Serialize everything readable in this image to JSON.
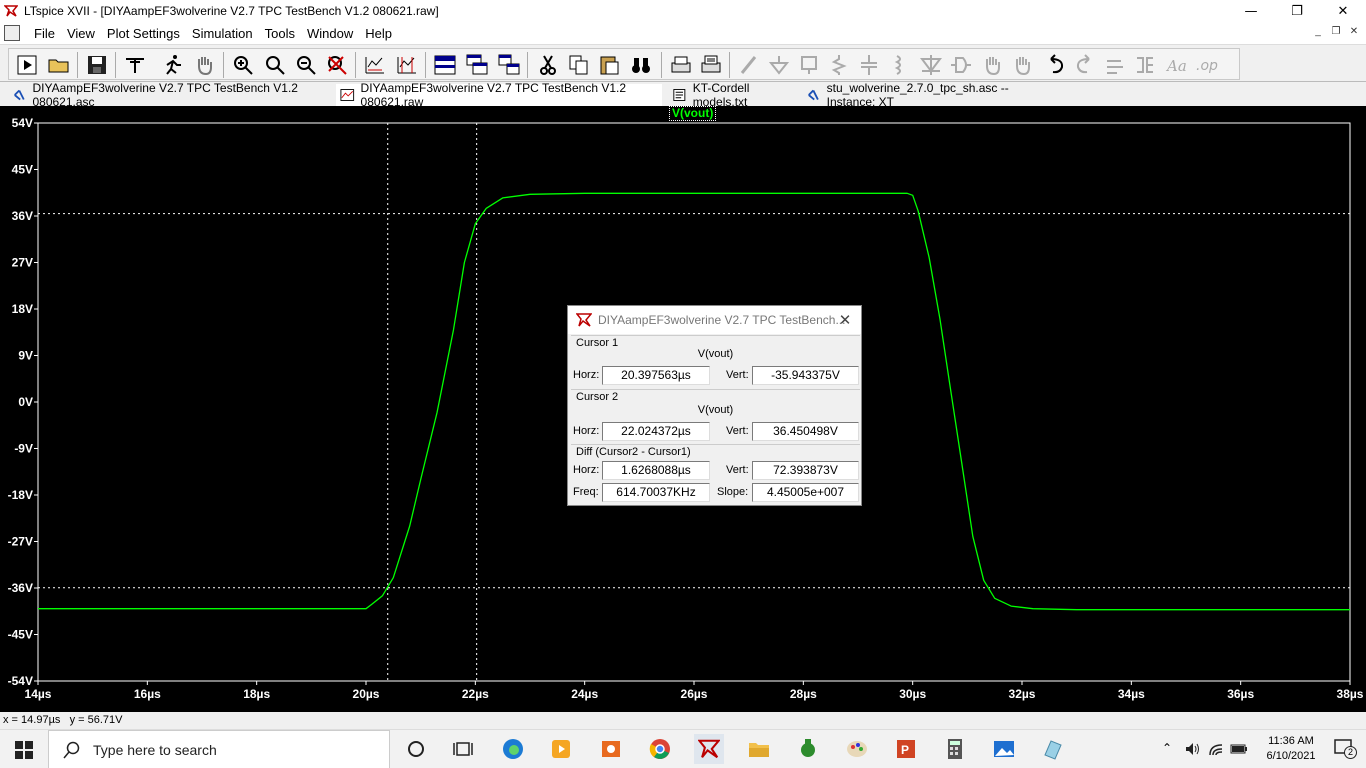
{
  "window": {
    "title": "LTspice XVII - [DIYAampEF3wolverine V2.7 TPC TestBench V1.2 080621.raw]",
    "minimize_glyph": "—",
    "maximize_glyph": "❐",
    "close_glyph": "✕"
  },
  "menu": {
    "items": [
      "File",
      "View",
      "Plot Settings",
      "Simulation",
      "Tools",
      "Window",
      "Help"
    ],
    "mdi_glyphs": [
      "_",
      "❐",
      "✕"
    ]
  },
  "tabs": [
    {
      "label": "DIYAampEF3wolverine V2.7 TPC TestBench V1.2 080621.asc",
      "icon": "schematic-icon",
      "active": false
    },
    {
      "label": "DIYAampEF3wolverine V2.7 TPC TestBench V1.2 080621.raw",
      "icon": "waveform-icon",
      "active": true
    },
    {
      "label": "KT-Cordell models.txt",
      "icon": "text-file-icon",
      "active": false
    },
    {
      "label": "stu_wolverine_2.7.0_tpc_sh.asc -- Instance: XT",
      "icon": "schematic-icon",
      "active": false
    }
  ],
  "plot": {
    "trace_label": "V(vout)",
    "trace_color": "#00ff00",
    "background": "#000000",
    "cursor_line_color": "#ffffff"
  },
  "chart_data": {
    "type": "line",
    "title": "",
    "xlabel": "",
    "ylabel": "",
    "xlim": [
      14,
      38
    ],
    "ylim": [
      -54,
      54
    ],
    "x_unit": "µs",
    "y_unit": "V",
    "x_ticks": [
      "14µs",
      "16µs",
      "18µs",
      "20µs",
      "22µs",
      "24µs",
      "26µs",
      "28µs",
      "30µs",
      "32µs",
      "34µs",
      "36µs",
      "38µs"
    ],
    "y_ticks": [
      "54V",
      "45V",
      "36V",
      "27V",
      "18V",
      "9V",
      "0V",
      "-9V",
      "-18V",
      "-27V",
      "-36V",
      "-45V",
      "-54V"
    ],
    "grid": false,
    "series": [
      {
        "name": "V(vout)",
        "x": [
          14.0,
          20.0,
          20.1,
          20.3,
          20.5,
          20.8,
          21.0,
          21.3,
          21.6,
          21.8,
          22.0,
          22.2,
          22.5,
          23.0,
          24.0,
          26.0,
          28.0,
          29.9,
          30.0,
          30.1,
          30.3,
          30.5,
          30.7,
          30.9,
          31.1,
          31.3,
          31.5,
          31.8,
          32.2,
          33.0,
          38.0
        ],
        "y": [
          -40.0,
          -40.0,
          -39.2,
          -37.5,
          -34.0,
          -24.0,
          -15.0,
          -2.0,
          14.0,
          27.0,
          34.5,
          37.5,
          39.5,
          40.2,
          40.4,
          40.4,
          40.4,
          40.4,
          40.0,
          37.0,
          28.0,
          16.0,
          2.0,
          -12.0,
          -26.0,
          -34.5,
          -38.0,
          -39.5,
          -40.0,
          -40.2,
          -40.2
        ]
      }
    ],
    "cursors": {
      "cursor1": {
        "x": 20.397563,
        "y": -35.943375
      },
      "cursor2": {
        "x": 22.024372,
        "y": 36.450498
      }
    }
  },
  "cursor_dialog": {
    "title": "DIYAampEF3wolverine V2.7 TPC TestBench...",
    "close_glyph": "✕",
    "cursor1": {
      "group": "Cursor 1",
      "trace": "V(vout)",
      "horz_label": "Horz:",
      "horz": "20.397563µs",
      "vert_label": "Vert:",
      "vert": "-35.943375V"
    },
    "cursor2": {
      "group": "Cursor 2",
      "trace": "V(vout)",
      "horz_label": "Horz:",
      "horz": "22.024372µs",
      "vert_label": "Vert:",
      "vert": "36.450498V"
    },
    "diff": {
      "group": "Diff (Cursor2 - Cursor1)",
      "horz_label": "Horz:",
      "horz": "1.6268088µs",
      "vert_label": "Vert:",
      "vert": "72.393873V",
      "freq_label": "Freq:",
      "freq": "614.70037KHz",
      "slope_label": "Slope:",
      "slope": "4.45005e+007"
    }
  },
  "status": {
    "x": "x = 14.97µs",
    "y": "y = 56.71V"
  },
  "taskbar": {
    "search_placeholder": "Type here to search",
    "time": "11:36 AM",
    "date": "6/10/2021",
    "notification_count": "2"
  }
}
